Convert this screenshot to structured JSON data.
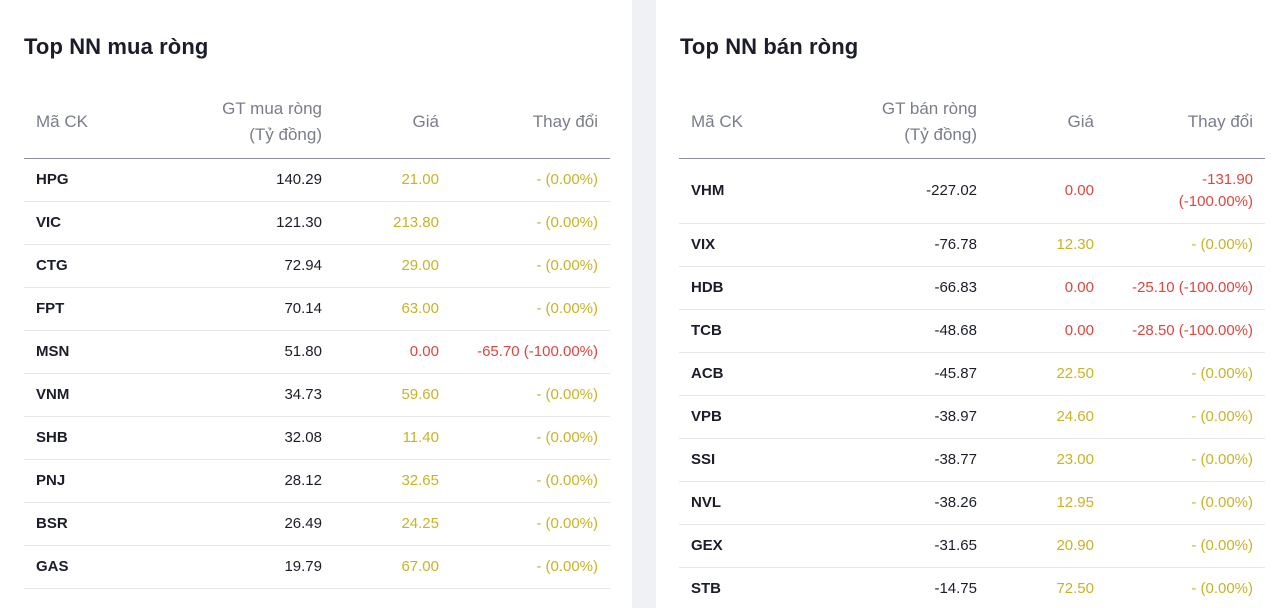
{
  "colors": {
    "reference": "#c9b326",
    "down": "#e0453f"
  },
  "buy": {
    "title": "Top NN mua ròng",
    "headers": {
      "symbol": "Mã CK",
      "value_l1": "GT mua ròng",
      "value_l2": "(Tỷ đồng)",
      "price": "Giá",
      "change": "Thay đổi"
    },
    "rows": [
      {
        "symbol": "HPG",
        "value": "140.29",
        "price": "21.00",
        "change": "- (0.00%)",
        "trend": "ref"
      },
      {
        "symbol": "VIC",
        "value": "121.30",
        "price": "213.80",
        "change": "- (0.00%)",
        "trend": "ref"
      },
      {
        "symbol": "CTG",
        "value": "72.94",
        "price": "29.00",
        "change": "- (0.00%)",
        "trend": "ref"
      },
      {
        "symbol": "FPT",
        "value": "70.14",
        "price": "63.00",
        "change": "- (0.00%)",
        "trend": "ref"
      },
      {
        "symbol": "MSN",
        "value": "51.80",
        "price": "0.00",
        "change": "-65.70 (-100.00%)",
        "trend": "down"
      },
      {
        "symbol": "VNM",
        "value": "34.73",
        "price": "59.60",
        "change": "- (0.00%)",
        "trend": "ref"
      },
      {
        "symbol": "SHB",
        "value": "32.08",
        "price": "11.40",
        "change": "- (0.00%)",
        "trend": "ref"
      },
      {
        "symbol": "PNJ",
        "value": "28.12",
        "price": "32.65",
        "change": "- (0.00%)",
        "trend": "ref"
      },
      {
        "symbol": "BSR",
        "value": "26.49",
        "price": "24.25",
        "change": "- (0.00%)",
        "trend": "ref"
      },
      {
        "symbol": "GAS",
        "value": "19.79",
        "price": "67.00",
        "change": "- (0.00%)",
        "trend": "ref"
      }
    ]
  },
  "sell": {
    "title": "Top NN bán ròng",
    "headers": {
      "symbol": "Mã CK",
      "value_l1": "GT bán ròng",
      "value_l2": "(Tỷ đồng)",
      "price": "Giá",
      "change": "Thay đổi"
    },
    "rows": [
      {
        "symbol": "VHM",
        "value": "-227.02",
        "price": "0.00",
        "change_l1": "-131.90",
        "change_l2": "(-100.00%)",
        "trend": "down"
      },
      {
        "symbol": "VIX",
        "value": "-76.78",
        "price": "12.30",
        "change": "- (0.00%)",
        "trend": "ref"
      },
      {
        "symbol": "HDB",
        "value": "-66.83",
        "price": "0.00",
        "change": "-25.10 (-100.00%)",
        "trend": "down"
      },
      {
        "symbol": "TCB",
        "value": "-48.68",
        "price": "0.00",
        "change": "-28.50 (-100.00%)",
        "trend": "down"
      },
      {
        "symbol": "ACB",
        "value": "-45.87",
        "price": "22.50",
        "change": "- (0.00%)",
        "trend": "ref"
      },
      {
        "symbol": "VPB",
        "value": "-38.97",
        "price": "24.60",
        "change": "- (0.00%)",
        "trend": "ref"
      },
      {
        "symbol": "SSI",
        "value": "-38.77",
        "price": "23.00",
        "change": "- (0.00%)",
        "trend": "ref"
      },
      {
        "symbol": "NVL",
        "value": "-38.26",
        "price": "12.95",
        "change": "- (0.00%)",
        "trend": "ref"
      },
      {
        "symbol": "GEX",
        "value": "-31.65",
        "price": "20.90",
        "change": "- (0.00%)",
        "trend": "ref"
      },
      {
        "symbol": "STB",
        "value": "-14.75",
        "price": "72.50",
        "change": "- (0.00%)",
        "trend": "ref"
      }
    ]
  }
}
